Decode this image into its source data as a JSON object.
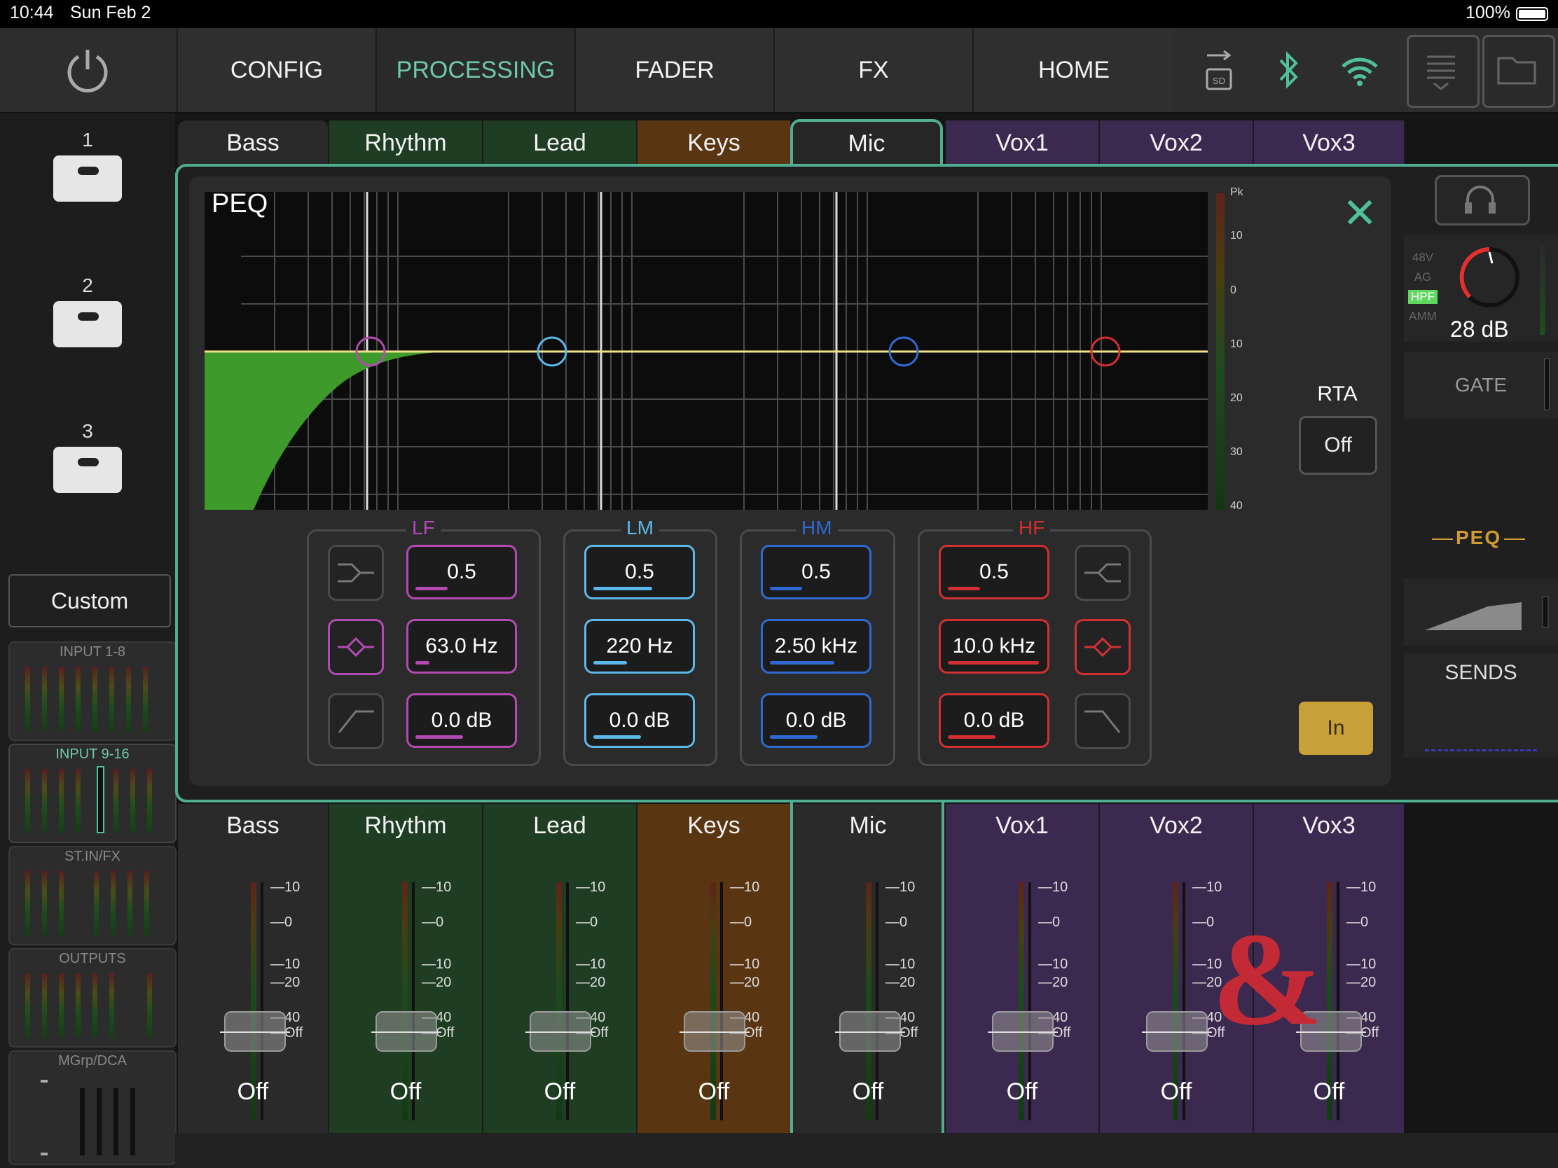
{
  "status": {
    "time": "10:44",
    "date": "Sun Feb 2",
    "battery": "100%"
  },
  "nav": {
    "tabs": [
      "CONFIG",
      "PROCESSING",
      "FADER",
      "FX",
      "HOME"
    ],
    "active": "PROCESSING"
  },
  "sidebar": {
    "scenes": [
      "1",
      "2",
      "3"
    ],
    "custom": "Custom",
    "banks": [
      "INPUT 1-8",
      "INPUT 9-16",
      "ST.IN/FX",
      "OUTPUTS",
      "MGrp/DCA"
    ],
    "active_bank": "INPUT 9-16"
  },
  "channel_tabs": [
    "Bass",
    "Rhythm",
    "Lead",
    "Keys",
    "Mic",
    "Vox1",
    "Vox2",
    "Vox3"
  ],
  "selected_channel": "Mic",
  "peq": {
    "title": "PEQ",
    "meter_labels": [
      "Pk",
      "10",
      "0",
      "10",
      "20",
      "30",
      "40"
    ],
    "bands": {
      "lf": {
        "label": "LF",
        "q": "0.5",
        "freq": "63.0 Hz",
        "gain": "0.0 dB",
        "color": "#b34ab3"
      },
      "lm": {
        "label": "LM",
        "q": "0.5",
        "freq": "220 Hz",
        "gain": "0.0 dB",
        "color": "#5cb8ea"
      },
      "hm": {
        "label": "HM",
        "q": "0.5",
        "freq": "2.50 kHz",
        "gain": "0.0 dB",
        "color": "#2f6ad2"
      },
      "hf": {
        "label": "HF",
        "q": "0.5",
        "freq": "10.0 kHz",
        "gain": "0.0 dB",
        "color": "#d23030"
      }
    },
    "rta_label": "RTA",
    "rta_value": "Off",
    "in_label": "In"
  },
  "right_panel": {
    "preamp_labels": [
      "48V",
      "AG",
      "HPF",
      "AMM"
    ],
    "gain": "28 dB",
    "gate": "GATE",
    "peq": "PEQ",
    "sends": "SENDS"
  },
  "strips": [
    {
      "name": "Bass",
      "value": "Off"
    },
    {
      "name": "Rhythm",
      "value": "Off"
    },
    {
      "name": "Lead",
      "value": "Off"
    },
    {
      "name": "Keys",
      "value": "Off"
    },
    {
      "name": "Mic",
      "value": "Off"
    },
    {
      "name": "Vox1",
      "value": "Off"
    },
    {
      "name": "Vox2",
      "value": "Off"
    },
    {
      "name": "Vox3",
      "value": "Off"
    }
  ],
  "fader_scale": [
    "10",
    "0",
    "10",
    "20",
    "40",
    "Off"
  ],
  "logo": "&"
}
